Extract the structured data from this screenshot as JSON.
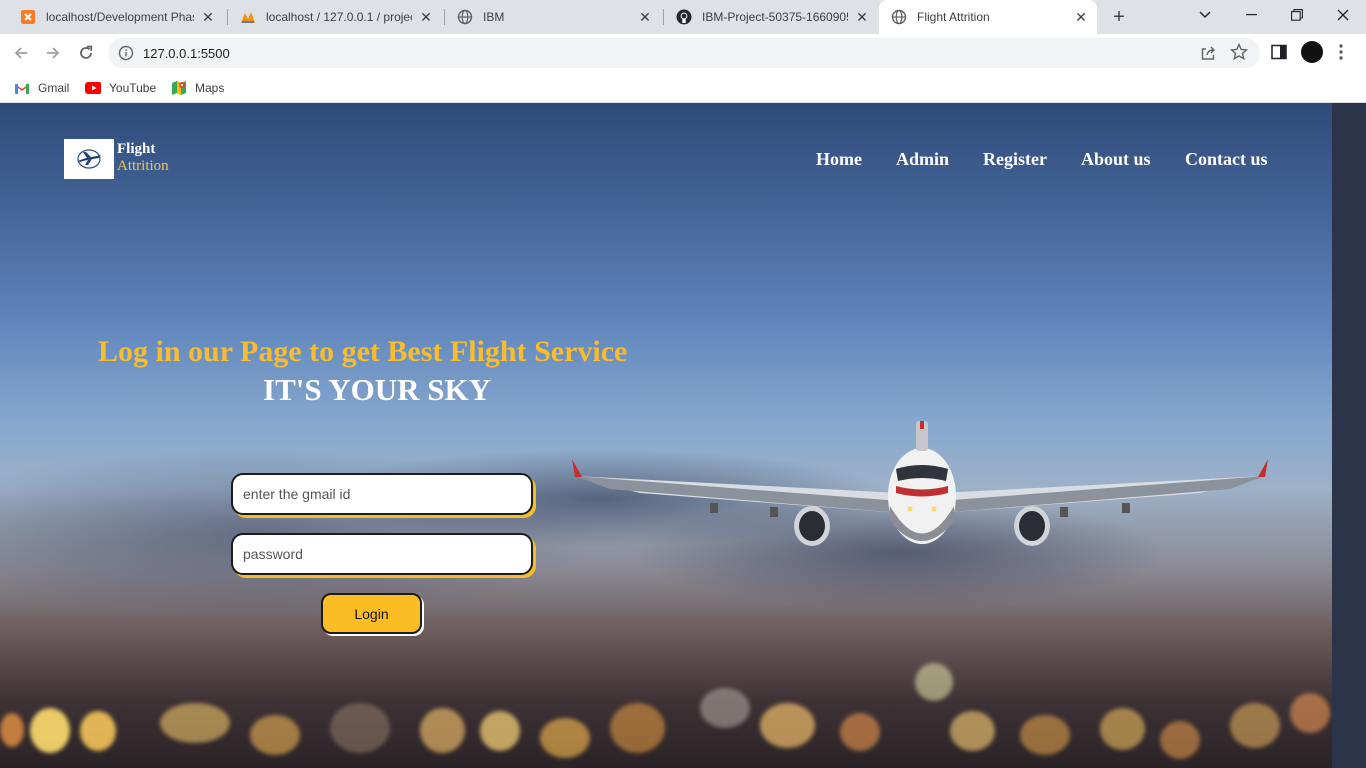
{
  "browser": {
    "tabs": [
      {
        "title": "localhost/Development Phase",
        "icon": "xampp-icon"
      },
      {
        "title": "localhost / 127.0.0.1 / project",
        "icon": "phpmyadmin-icon"
      },
      {
        "title": "IBM",
        "icon": "globe-icon"
      },
      {
        "title": "IBM-Project-50375-1660905",
        "icon": "github-icon"
      },
      {
        "title": "Flight Attrition",
        "icon": "globe-icon",
        "active": true
      }
    ],
    "new_tab": "+",
    "url": "127.0.0.1:5500",
    "bookmarks": [
      {
        "label": "Gmail",
        "icon": "gmail-icon"
      },
      {
        "label": "YouTube",
        "icon": "youtube-icon"
      },
      {
        "label": "Maps",
        "icon": "maps-icon"
      }
    ]
  },
  "page": {
    "logo": {
      "line1": "Flight",
      "line2": "Attrition"
    },
    "nav": [
      "Home",
      "Admin",
      "Register",
      "About us",
      "Contact us"
    ],
    "headline": "Log in our Page to get Best Flight Service",
    "subheadline": "IT'S YOUR SKY",
    "form": {
      "email_placeholder": "enter the gmail id",
      "password_placeholder": "password",
      "login_label": "Login"
    }
  },
  "colors": {
    "accent": "#f8bd2e",
    "button": "#fbbd23",
    "tabstrip": "#dee1e6"
  }
}
